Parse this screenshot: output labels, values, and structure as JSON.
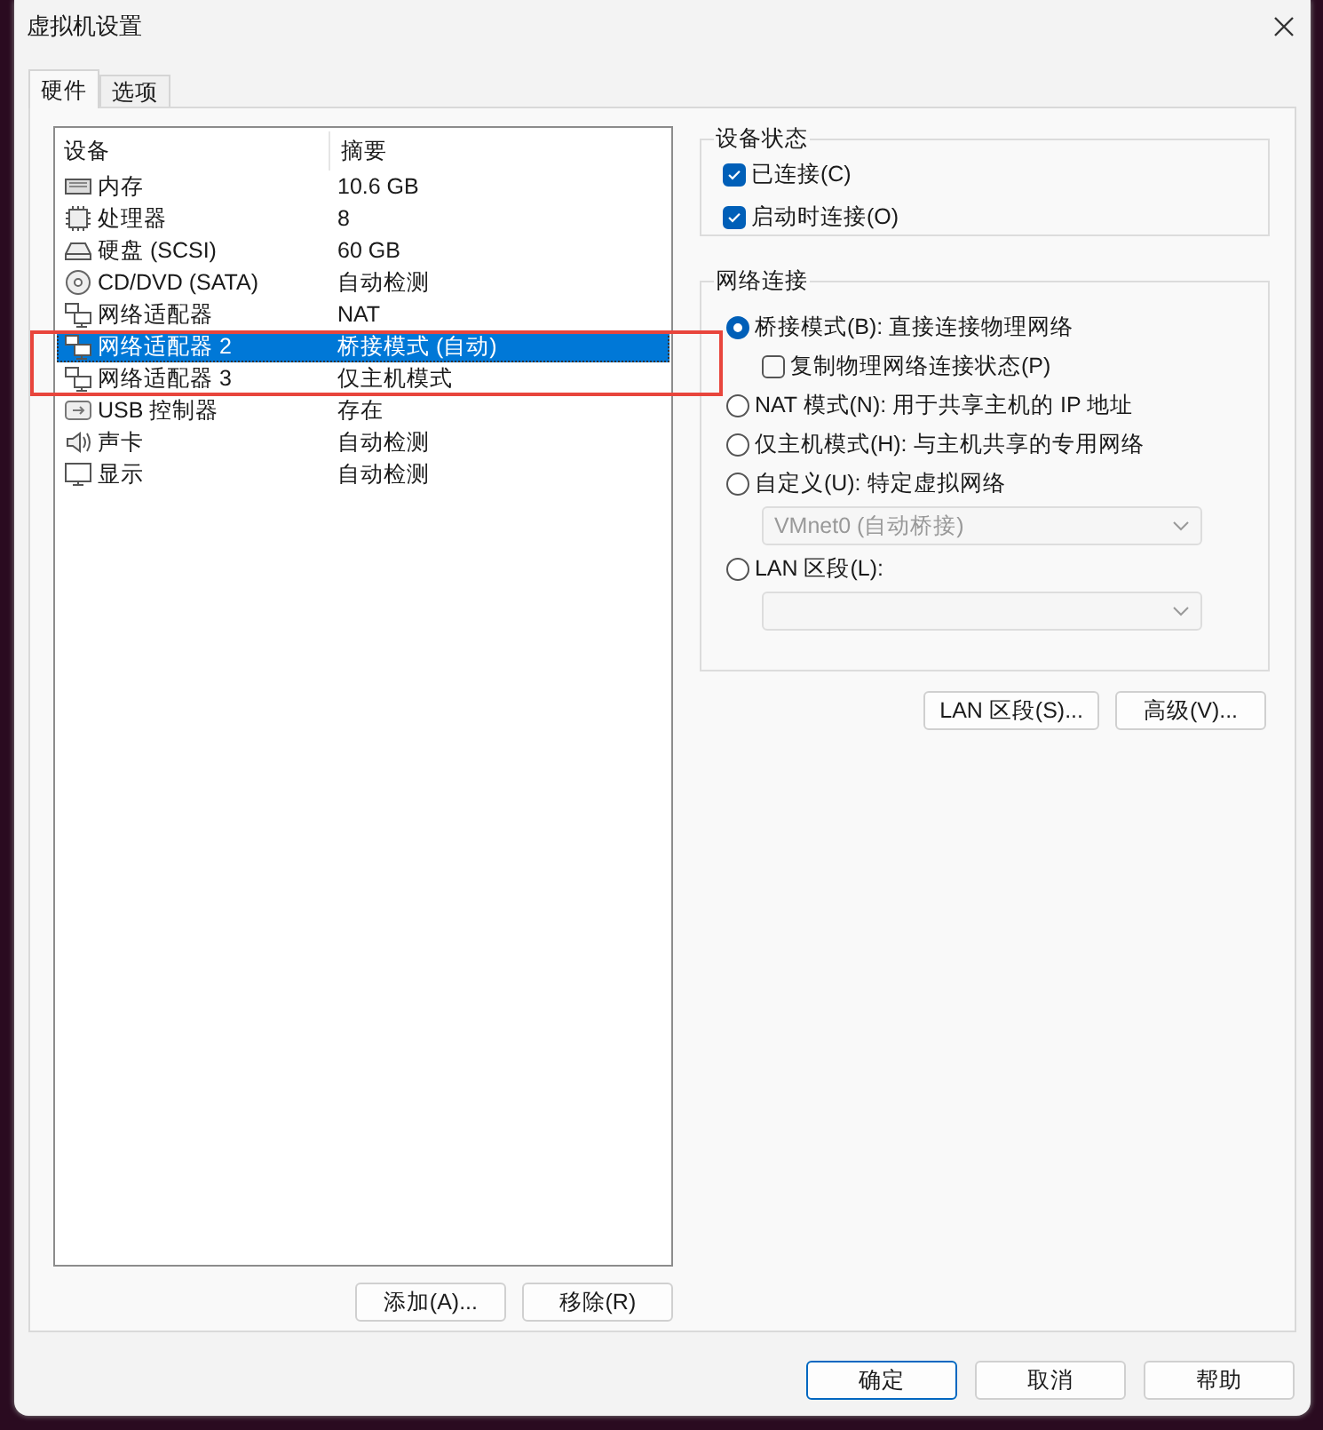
{
  "window": {
    "title": "虚拟机设置"
  },
  "tabs": [
    {
      "label": "硬件",
      "selected": true
    },
    {
      "label": "选项",
      "selected": false
    }
  ],
  "device_list": {
    "columns": [
      "设备",
      "摘要"
    ],
    "rows": [
      {
        "kind": "memory",
        "device": "内存",
        "summary": "10.6 GB",
        "selected": false
      },
      {
        "kind": "cpu",
        "device": "处理器",
        "summary": "8",
        "selected": false
      },
      {
        "kind": "disk",
        "device": "硬盘 (SCSI)",
        "summary": "60 GB",
        "selected": false
      },
      {
        "kind": "cdrom",
        "device": "CD/DVD (SATA)",
        "summary": "自动检测",
        "selected": false
      },
      {
        "kind": "network",
        "device": "网络适配器",
        "summary": "NAT",
        "selected": false
      },
      {
        "kind": "network",
        "device": "网络适配器 2",
        "summary": "桥接模式 (自动)",
        "selected": true
      },
      {
        "kind": "network",
        "device": "网络适配器 3",
        "summary": "仅主机模式",
        "selected": false
      },
      {
        "kind": "usb",
        "device": "USB 控制器",
        "summary": "存在",
        "selected": false
      },
      {
        "kind": "sound",
        "device": "声卡",
        "summary": "自动检测",
        "selected": false
      },
      {
        "kind": "display",
        "device": "显示",
        "summary": "自动检测",
        "selected": false
      }
    ],
    "buttons": [
      "添加(A)...",
      "移除(R)"
    ]
  },
  "highlight": {
    "shown": true
  },
  "device_status": {
    "title": "设备状态",
    "options": [
      {
        "label": "已连接(C)",
        "checked": true
      },
      {
        "label": "启动时连接(O)",
        "checked": true
      }
    ]
  },
  "network_connection": {
    "title": "网络连接",
    "options": [
      {
        "kind": "radio",
        "label": "桥接模式(B): 直接连接物理网络",
        "selected": true
      },
      {
        "kind": "checkbox",
        "label": "复制物理网络连接状态(P)",
        "checked": false
      },
      {
        "kind": "radio",
        "label": "NAT 模式(N): 用于共享主机的 IP 地址",
        "selected": false
      },
      {
        "kind": "radio",
        "label": "仅主机模式(H): 与主机共享的专用网络",
        "selected": false
      },
      {
        "kind": "radio",
        "label": "自定义(U): 特定虚拟网络",
        "selected": false
      },
      {
        "kind": "select",
        "value": "VMnet0 (自动桥接)",
        "disabled": true
      },
      {
        "kind": "radio",
        "label": "LAN 区段(L):",
        "selected": false
      },
      {
        "kind": "select",
        "disabled": true
      }
    ],
    "buttons": [
      "LAN 区段(S)...",
      "高级(V)..."
    ]
  },
  "dialog_buttons": [
    {
      "label": "确定",
      "default": true
    },
    {
      "label": "取消",
      "default": false
    },
    {
      "label": "帮助",
      "default": false
    }
  ]
}
